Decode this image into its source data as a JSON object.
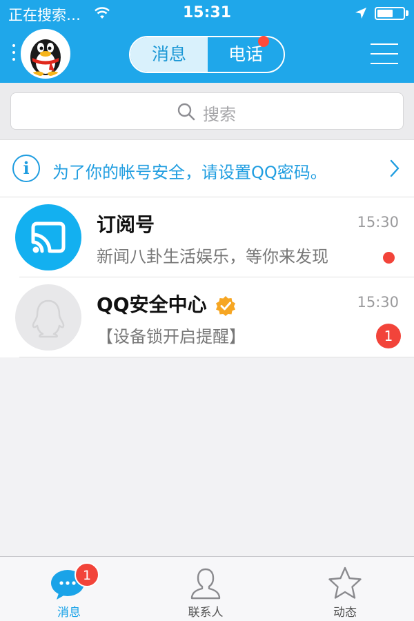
{
  "status_bar": {
    "carrier": "正在搜索…",
    "time": "15:31"
  },
  "header": {
    "segments": [
      {
        "label": "消息",
        "selected": true
      },
      {
        "label": "电话",
        "selected": false,
        "has_dot": true
      }
    ]
  },
  "search": {
    "placeholder": "搜索"
  },
  "notice": {
    "text": "为了你的帐号安全，请设置QQ密码。"
  },
  "conversations": [
    {
      "title": "订阅号",
      "time": "15:30",
      "preview": "新闻八卦生活娱乐，等你来发现",
      "indicator": "dot"
    },
    {
      "title": "QQ安全中心",
      "time": "15:30",
      "preview": "【设备锁开启提醒】",
      "verified": true,
      "badge": "1"
    }
  ],
  "tabbar": {
    "tabs": [
      {
        "label": "消息",
        "badge": "1",
        "active": true
      },
      {
        "label": "联系人",
        "active": false
      },
      {
        "label": "动态",
        "active": false
      }
    ]
  },
  "colors": {
    "brand_blue": "#1fa7ea",
    "alert_red": "#f2443a",
    "verified_orange": "#f6a623"
  }
}
